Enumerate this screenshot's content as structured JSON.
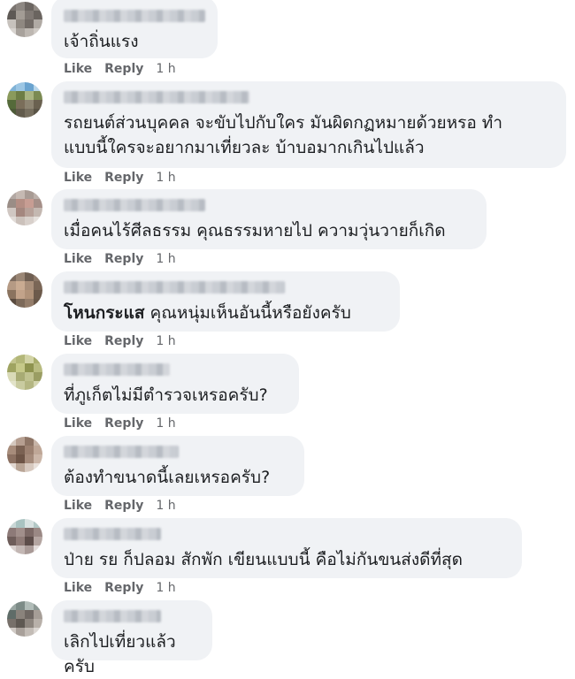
{
  "actions": {
    "like": "Like",
    "reply": "Reply"
  },
  "comments": [
    {
      "text": "เจ้าถิ่นแรง",
      "time": "1 h"
    },
    {
      "text": "รถยนต์ส่วนบุคคล จะขับไปกับใคร มันผิดกฏหมายด้วยหรอ ทำ\nแบบนี้ใครจะอยากมาเที่ยวละ บ้าบอมากเกินไปแล้ว",
      "time": "1 h"
    },
    {
      "text": "เมื่อคนไร้ศีลธรรม คุณธรรมหายไป ความวุ่นวายก็เกิด",
      "time": "1 h"
    },
    {
      "mention": "โหนกระแส",
      "text": " คุณหนุ่มเห็นอันนี้หรือยังครับ",
      "time": "1 h"
    },
    {
      "text": "ที่ภูเก็ตไม่มีตำรวจเหรอครับ?",
      "time": "1 h"
    },
    {
      "text": "ต้องทำขนาดนี้เลยเหรอครับ?",
      "time": "1 h"
    },
    {
      "text": "ป่าย รย ก็ปลอม สักพัก เขียนแบบนี้ คือไม่กันขนส่งดีที่สุด",
      "time": "1 h"
    },
    {
      "text": "เลิกไปเที่ยวแล้วครับ",
      "time": ""
    }
  ]
}
